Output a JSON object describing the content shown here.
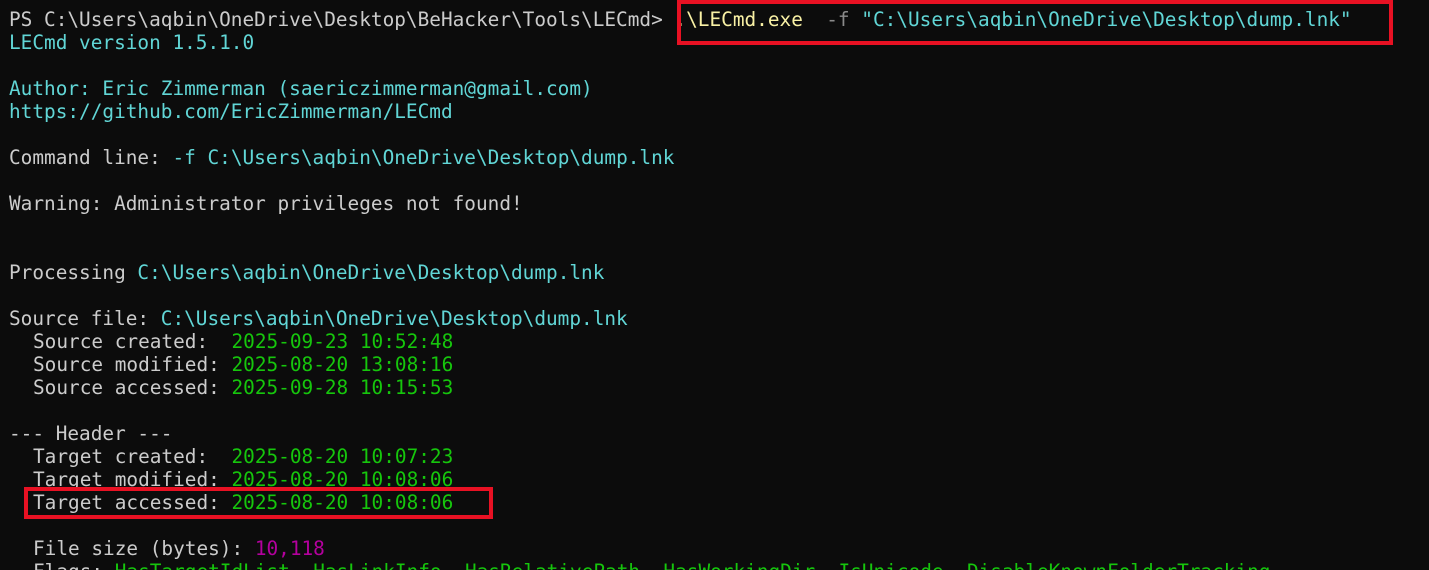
{
  "prompt": {
    "ps": "PS C:\\Users\\aqbin\\OneDrive\\Desktop\\BeHacker\\Tools\\LECmd>",
    "exe": ".\\LECmd.exe",
    "flag": "-f",
    "arg": "\"C:\\Users\\aqbin\\OneDrive\\Desktop\\dump.lnk\""
  },
  "version": "LECmd version 1.5.1.0",
  "author": "Author: Eric Zimmerman (saericzimmerman@gmail.com)",
  "url": "https://github.com/EricZimmerman/LECmd",
  "command_line": {
    "label": "Command line: ",
    "value": "-f C:\\Users\\aqbin\\OneDrive\\Desktop\\dump.lnk"
  },
  "warning": "Warning: Administrator privileges not found!",
  "processing": {
    "label": "Processing ",
    "path": "C:\\Users\\aqbin\\OneDrive\\Desktop\\dump.lnk"
  },
  "source": {
    "label": "Source file: ",
    "path": "C:\\Users\\aqbin\\OneDrive\\Desktop\\dump.lnk",
    "created_label": "Source created:  ",
    "created": "2025-09-23 10:52:48",
    "modified_label": "Source modified: ",
    "modified": "2025-08-20 13:08:16",
    "accessed_label": "Source accessed: ",
    "accessed": "2025-09-28 10:15:53"
  },
  "header": {
    "title": "--- Header ---",
    "target_created_label": "Target created:  ",
    "target_created": "2025-08-20 10:07:23",
    "target_modified_label": "Target modified: ",
    "target_modified": "2025-08-20 10:08:06",
    "target_accessed_label": "Target accessed: ",
    "target_accessed": "2025-08-20 10:08:06",
    "file_size_label": "File size (bytes): ",
    "file_size": "10,118",
    "flags_label": "Flags: ",
    "flags": "HasTargetIdList, HasLinkInfo, HasRelativePath, HasWorkingDir, IsUnicode, DisableKnownFolderTracking"
  },
  "colors": {
    "background": "#0c0c0c",
    "default_text": "#cccccc",
    "cyan": "#61d6d6",
    "yellow": "#f9f1a5",
    "green": "#16c60c",
    "magenta": "#b4009e",
    "highlight": "#e81123"
  }
}
